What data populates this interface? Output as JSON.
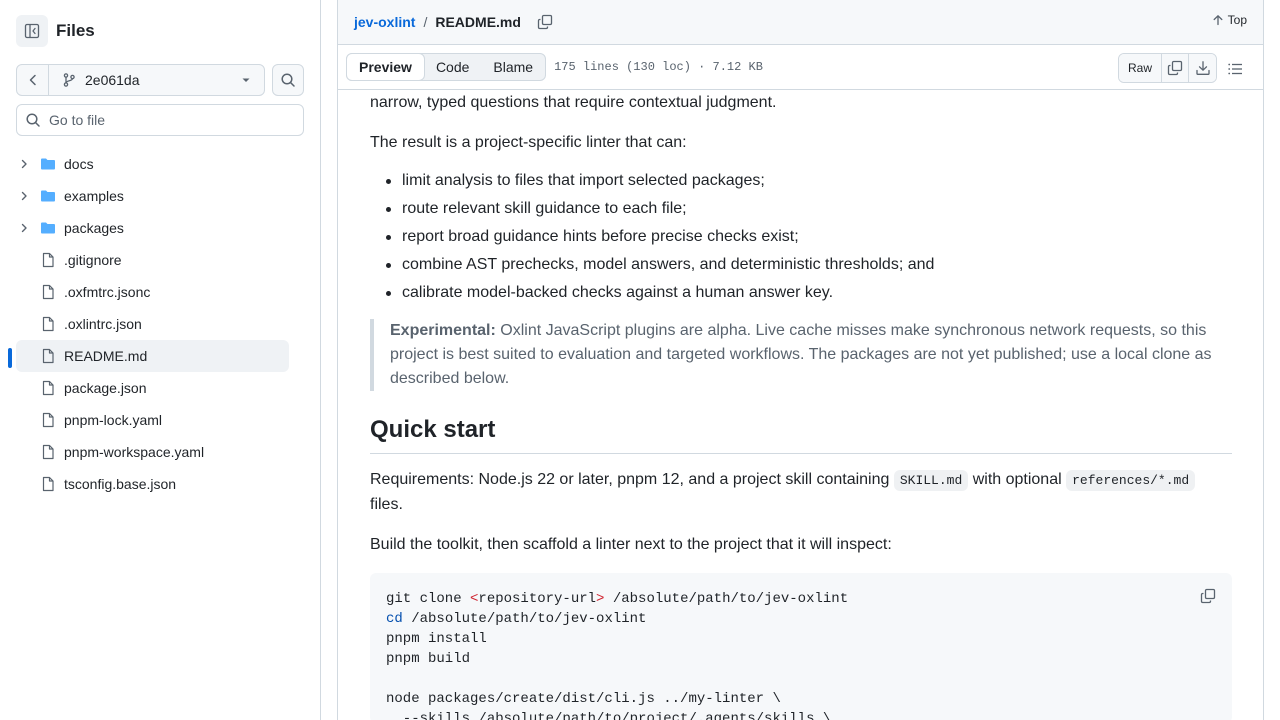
{
  "sidebar": {
    "title": "Files",
    "branch": "2e061da",
    "go_to_file_placeholder": "Go to file",
    "items": [
      {
        "type": "folder",
        "label": "docs"
      },
      {
        "type": "folder",
        "label": "examples"
      },
      {
        "type": "folder",
        "label": "packages"
      },
      {
        "type": "file",
        "label": ".gitignore"
      },
      {
        "type": "file",
        "label": ".oxfmtrc.jsonc"
      },
      {
        "type": "file",
        "label": ".oxlintrc.json"
      },
      {
        "type": "file",
        "label": "README.md",
        "selected": true
      },
      {
        "type": "file",
        "label": "package.json"
      },
      {
        "type": "file",
        "label": "pnpm-lock.yaml"
      },
      {
        "type": "file",
        "label": "pnpm-workspace.yaml"
      },
      {
        "type": "file",
        "label": "tsconfig.base.json"
      }
    ]
  },
  "header": {
    "repo": "jev-oxlint",
    "separator": "/",
    "file": "README.md",
    "top_label": "Top"
  },
  "filebar": {
    "tabs": [
      "Preview",
      "Code",
      "Blame"
    ],
    "active_tab": "Preview",
    "info": "175 lines (130 loc) · 7.12 KB",
    "raw_label": "Raw"
  },
  "readme": {
    "intro_tail": "narrow, typed questions that require contextual judgment.",
    "result_intro": "The result is a project-specific linter that can:",
    "bullets": [
      "limit analysis to files that import selected packages;",
      "route relevant skill guidance to each file;",
      "report broad guidance hints before precise checks exist;",
      "combine AST prechecks, model answers, and deterministic thresholds; and",
      "calibrate model-backed checks against a human answer key."
    ],
    "note_label": "Experimental:",
    "note_text": " Oxlint JavaScript plugins are alpha. Live cache misses make synchronous network requests, so this project is best suited to evaluation and targeted workflows. The packages are not yet published; use a local clone as described below.",
    "quickstart_heading": "Quick start",
    "req_a": "Requirements: Node.js 22 or later, pnpm 12, and a project skill containing ",
    "req_code1": "SKILL.md",
    "req_b": " with optional ",
    "req_code2": "references/*.md",
    "req_c": " files.",
    "build_text": "Build the toolkit, then scaffold a linter next to the project that it will inspect:",
    "code": {
      "l1_a": "git clone ",
      "l1_b": "<",
      "l1_c": "repository-url",
      "l1_d": ">",
      "l1_e": " /absolute/path/to/jev-oxlint",
      "l2_a": "cd",
      "l2_b": " /absolute/path/to/jev-oxlint",
      "l3": "pnpm install",
      "l4": "pnpm build",
      "l5": "",
      "l6": "node packages/create/dist/cli.js ../my-linter \\",
      "l7": "  --skills /absolute/path/to/project/.agents/skills \\"
    }
  }
}
